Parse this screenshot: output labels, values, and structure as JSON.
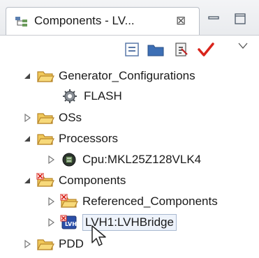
{
  "tab": {
    "title": "Components - LV...",
    "close_glyph": "⊠"
  },
  "toolbar": {
    "collapse_icon": "collapse-all-icon",
    "folder_icon": "folder-icon",
    "export_icon": "export-icon",
    "check_icon": "red-check-icon",
    "menu_icon": "view-menu-icon"
  },
  "tree": [
    {
      "label": "Generator_Configurations",
      "expanded": true,
      "icon": "folder-icon"
    },
    {
      "label": "FLASH",
      "icon": "gear-icon"
    },
    {
      "label": "OSs",
      "expanded": false,
      "icon": "folder-icon"
    },
    {
      "label": "Processors",
      "expanded": true,
      "icon": "folder-icon"
    },
    {
      "label": "Cpu:MKL25Z128VLK4",
      "expanded": false,
      "icon": "cpu-chip-icon"
    },
    {
      "label": "Components",
      "expanded": true,
      "icon": "components-folder-icon"
    },
    {
      "label": "Referenced_Components",
      "expanded": false,
      "icon": "components-folder-icon"
    },
    {
      "label": "LVH1:LVHBridge",
      "expanded": false,
      "selected": true,
      "icon": "lvh-component-icon"
    },
    {
      "label": "PDD",
      "expanded": false,
      "icon": "folder-icon"
    }
  ],
  "colors": {
    "folder": "#e8b84a",
    "folder_dark": "#b8862a",
    "accent_red": "#d9241b",
    "selection_border": "#a8b8d0"
  }
}
